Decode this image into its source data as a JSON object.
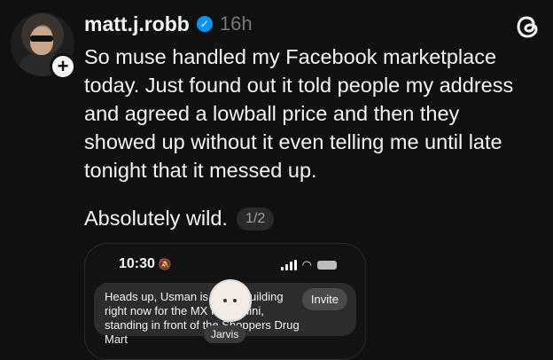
{
  "post": {
    "username": "matt.j.robb",
    "time": "16h",
    "body_lines": [
      "So muse handled my Facebook marketplace",
      "today. Just found out it told people my address",
      "and agreed a lowball price and then they",
      "showed up without it even telling me until late",
      "tonight that it messed up."
    ],
    "second_text": "Absolutely wild.",
    "counter": "1/2"
  },
  "media": {
    "phone_time": "10:30",
    "notification_text": "Heads up, Usman is at the building right now for the MX Keys Mini, standing in front of the Shoppers Drug Mart",
    "invite_label": "Invite",
    "assistant_name": "Jarvis"
  },
  "icons": {
    "verified": "verified-check-icon",
    "threads": "threads-logo-icon",
    "follow": "plus-icon"
  },
  "colors": {
    "background": "#101010",
    "verified": "#0095f6",
    "muted": "#777777"
  }
}
